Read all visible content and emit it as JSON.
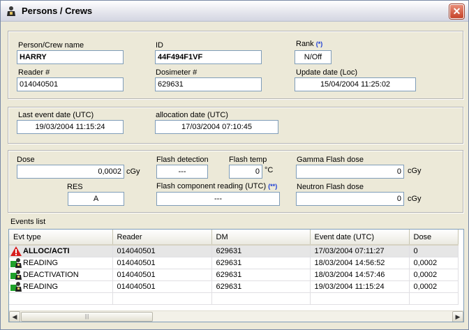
{
  "window": {
    "title": "Persons / Crews"
  },
  "person": {
    "name_label": "Person/Crew name",
    "name_value": "HARRY",
    "id_label": "ID",
    "id_value": "44F494F1VF",
    "rank_label": "Rank",
    "rank_marker": "(*)",
    "rank_value": "N/Off",
    "reader_label": "Reader #",
    "reader_value": "014040501",
    "dosimeter_label": "Dosimeter #",
    "dosimeter_value": "629631",
    "update_label": "Update date (Loc)",
    "update_value": "15/04/2004 11:25:02"
  },
  "dates": {
    "last_event_label": "Last event date (UTC)",
    "last_event_value": "19/03/2004 11:15:24",
    "allocation_label": "allocation date (UTC)",
    "allocation_value": "17/03/2004 07:10:45"
  },
  "dose": {
    "dose_label": "Dose",
    "dose_value": "0,0002",
    "dose_unit": "cGy",
    "flash_detection_label": "Flash detection",
    "flash_detection_value": "---",
    "flash_temp_label": "Flash temp",
    "flash_temp_value": "0",
    "flash_temp_unit": "°C",
    "gamma_label": "Gamma Flash dose",
    "gamma_value": "0",
    "gamma_unit": "cGy",
    "res_label": "RES",
    "res_value": "A",
    "flash_component_label": "Flash component reading (UTC)",
    "flash_component_marker": "(**)",
    "flash_component_value": "---",
    "neutron_label": "Neutron Flash dose",
    "neutron_value": "0",
    "neutron_unit": "cGy"
  },
  "events": {
    "label": "Events list",
    "columns": [
      "Evt type",
      "Reader",
      "DM",
      "Event date (UTC)",
      "Dose"
    ],
    "rows": [
      {
        "type": "ALLOC/ACTI",
        "icon": "warning-icon",
        "reader": "014040501",
        "dm": "629631",
        "date": "17/03/2004 07:11:27",
        "dose": "0"
      },
      {
        "type": "READING",
        "icon": "person-reading-icon",
        "reader": "014040501",
        "dm": "629631",
        "date": "18/03/2004 14:56:52",
        "dose": "0,0002"
      },
      {
        "type": "DEACTIVATION",
        "icon": "person-reading-icon",
        "reader": "014040501",
        "dm": "629631",
        "date": "18/03/2004 14:57:46",
        "dose": "0,0002"
      },
      {
        "type": "READING",
        "icon": "person-reading-icon",
        "reader": "014040501",
        "dm": "629631",
        "date": "19/03/2004 11:15:24",
        "dose": "0,0002"
      }
    ]
  },
  "colors": {
    "window_bg": "#ece9d8",
    "field_border": "#7f9db9",
    "close_red": "#c5432a",
    "marker_blue": "#1a3cd6"
  }
}
